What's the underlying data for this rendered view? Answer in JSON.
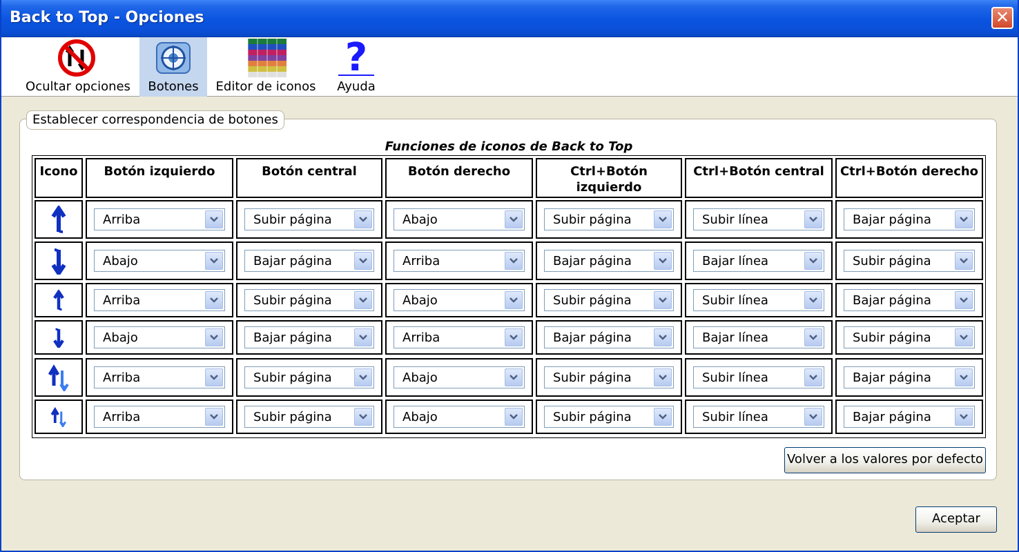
{
  "window": {
    "title": "Back to Top - Opciones"
  },
  "toolbar": {
    "items": [
      {
        "label": "Ocultar opciones",
        "icon": "hide-options-icon"
      },
      {
        "label": "Botones",
        "icon": "buttons-icon"
      },
      {
        "label": "Editor de iconos",
        "icon": "icon-editor-icon"
      },
      {
        "label": "Ayuda",
        "icon": "help-icon"
      }
    ],
    "active": "Botones"
  },
  "group": {
    "legend": "Establecer correspondencia de botones",
    "caption": "Funciones de iconos de Back to Top",
    "columns": [
      "Icono",
      "Botón izquierdo",
      "Botón central",
      "Botón derecho",
      "Ctrl+Botón izquierdo",
      "Ctrl+Botón central",
      "Ctrl+Botón derecho"
    ],
    "rows": [
      {
        "icon": "arrow-up-large-icon",
        "values": [
          "Arriba",
          "Subir página",
          "Abajo",
          "Subir página",
          "Subir línea",
          "Bajar página"
        ]
      },
      {
        "icon": "arrow-down-large-icon",
        "values": [
          "Abajo",
          "Bajar página",
          "Arriba",
          "Bajar página",
          "Bajar línea",
          "Subir página"
        ]
      },
      {
        "icon": "arrow-up-small-icon",
        "values": [
          "Arriba",
          "Subir página",
          "Abajo",
          "Subir página",
          "Subir línea",
          "Bajar página"
        ]
      },
      {
        "icon": "arrow-down-small-icon",
        "values": [
          "Abajo",
          "Bajar página",
          "Arriba",
          "Bajar página",
          "Bajar línea",
          "Subir página"
        ]
      },
      {
        "icon": "arrow-updown-large-icon",
        "values": [
          "Arriba",
          "Subir página",
          "Abajo",
          "Subir página",
          "Subir línea",
          "Bajar página"
        ]
      },
      {
        "icon": "arrow-updown-small-icon",
        "values": [
          "Arriba",
          "Subir página",
          "Abajo",
          "Subir página",
          "Subir línea",
          "Bajar página"
        ]
      }
    ],
    "reset_label": "Volver a los valores por defecto"
  },
  "footer": {
    "ok_label": "Aceptar"
  },
  "colors": {
    "titlebar": "#0a54e0",
    "arrow": "#1030c0",
    "arrow_light": "#3a7ef0"
  }
}
